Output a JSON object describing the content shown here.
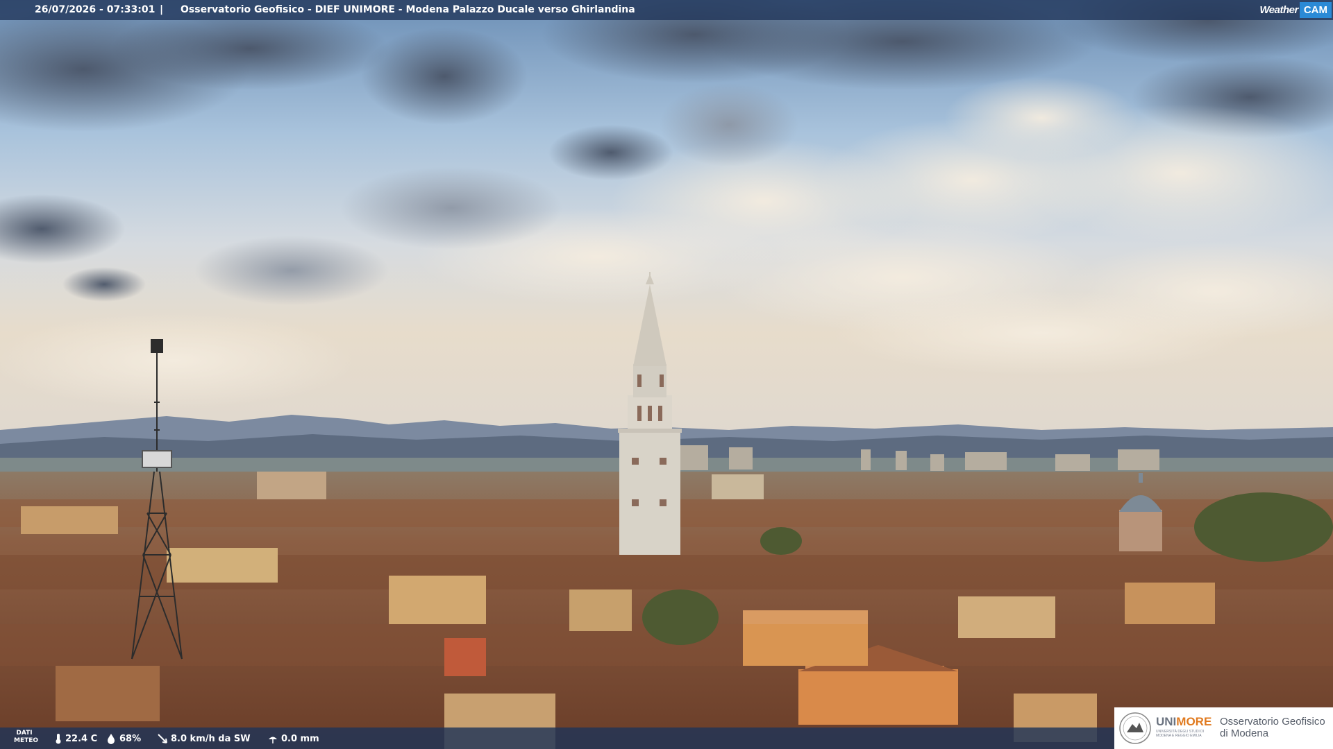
{
  "overlay": {
    "timestamp": "26/07/2026 - 07:33:01",
    "separator": "|",
    "title": "Osservatorio Geofisico - DIEF UNIMORE - Modena Palazzo Ducale verso Ghirlandina",
    "brand_weather": "Weather",
    "brand_cam": "CAM"
  },
  "weather": {
    "label_line1": "DATI",
    "label_line2": "METEO",
    "temperature": "22.4 C",
    "humidity": "68%",
    "wind": "8.0 km/h da SW",
    "rain": "0.0 mm"
  },
  "logo": {
    "uni_part1": "UNI",
    "uni_part2": "MORE",
    "subtitle": "UNIVERSITÀ DEGLI STUDI DI MODENA E REGGIO EMILIA",
    "observatory_line1": "Osservatorio Geofisico",
    "observatory_line2": "di Modena"
  },
  "colors": {
    "overlay_bar": "#203458",
    "brand_cam": "#2b8ad6",
    "logo_orange": "#e07a1f"
  }
}
